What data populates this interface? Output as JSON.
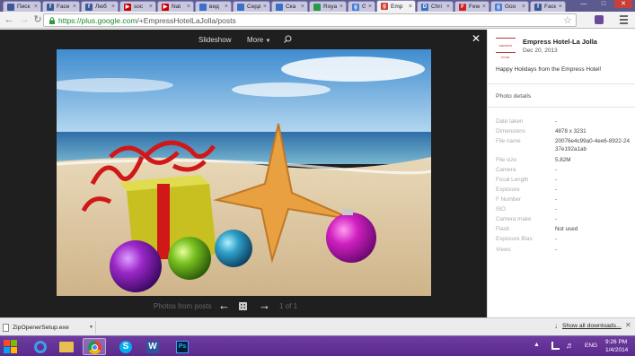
{
  "tabs": [
    {
      "title": "Писк",
      "fav": "#3b5998",
      "letter": ""
    },
    {
      "title": "Face",
      "fav": "#3b5998",
      "letter": "f"
    },
    {
      "title": "Люб",
      "fav": "#3b5998",
      "letter": "f"
    },
    {
      "title": "soc",
      "fav": "#cc0000",
      "letter": "▶"
    },
    {
      "title": "Nat",
      "fav": "#cc0000",
      "letter": "▶"
    },
    {
      "title": "вид",
      "fav": "#3b6fc8",
      "letter": ""
    },
    {
      "title": "Серд",
      "fav": "#3b6fc8",
      "letter": ""
    },
    {
      "title": "Ска",
      "fav": "#3b6fc8",
      "letter": ""
    },
    {
      "title": "Roya",
      "fav": "#2a9a4a",
      "letter": ""
    },
    {
      "title": "Goo",
      "fav": "#4a7cd8",
      "letter": "g"
    },
    {
      "title": "Emp",
      "fav": "#d04030",
      "letter": "g"
    },
    {
      "title": "Chri",
      "fav": "#3b6fc8",
      "letter": "D"
    },
    {
      "title": "Few",
      "fav": "#cc2222",
      "letter": "F"
    },
    {
      "title": "Goo",
      "fav": "#4a7cd8",
      "letter": "g"
    },
    {
      "title": "Face",
      "fav": "#3b5998",
      "letter": "f"
    }
  ],
  "address": {
    "secure": "https://",
    "host": "plus.google.com",
    "path": "/+EmpressHotelLaJolla/posts"
  },
  "lightbox": {
    "slideshow": "Slideshow",
    "more": "More",
    "photos_from_posts": "Photos from posts",
    "counter": "1 of 1"
  },
  "side": {
    "author": "Empress Hotel-La Jolla",
    "date": "Dec 20, 2013",
    "caption": "Happy Holidays from the Empress Hotel!",
    "details_title": "Photo details",
    "logo_text": "EMPRESS HOTEL",
    "details": [
      {
        "k": "Date taken",
        "v": "-"
      },
      {
        "k": "Dimensions",
        "v": "4878 x 3231"
      },
      {
        "k": "File name",
        "v": "20076e4c99a0-4ee6-8922-2437e192a1ab"
      },
      {
        "k": "File size",
        "v": "5.82M"
      },
      {
        "k": "Camera",
        "v": "-"
      },
      {
        "k": "Focal Length",
        "v": "-"
      },
      {
        "k": "Exposure",
        "v": "-"
      },
      {
        "k": "F Number",
        "v": "-"
      },
      {
        "k": "ISO",
        "v": "-"
      },
      {
        "k": "Camera make",
        "v": "-"
      },
      {
        "k": "Flash",
        "v": "Not used"
      },
      {
        "k": "Exposure Bias",
        "v": "-"
      },
      {
        "k": "Views",
        "v": "-"
      }
    ]
  },
  "download": {
    "file": "ZipOpenerSetup.exe",
    "show_all": "Show all downloads..."
  },
  "taskbar": {
    "lang": "ENG",
    "time": "9:26 PM",
    "date": "1/4/2014"
  },
  "colors": {
    "lightbox_bg": "#1f1f1f",
    "taskbar": "#5a2a8c",
    "url_green": "#1a8a2a"
  }
}
